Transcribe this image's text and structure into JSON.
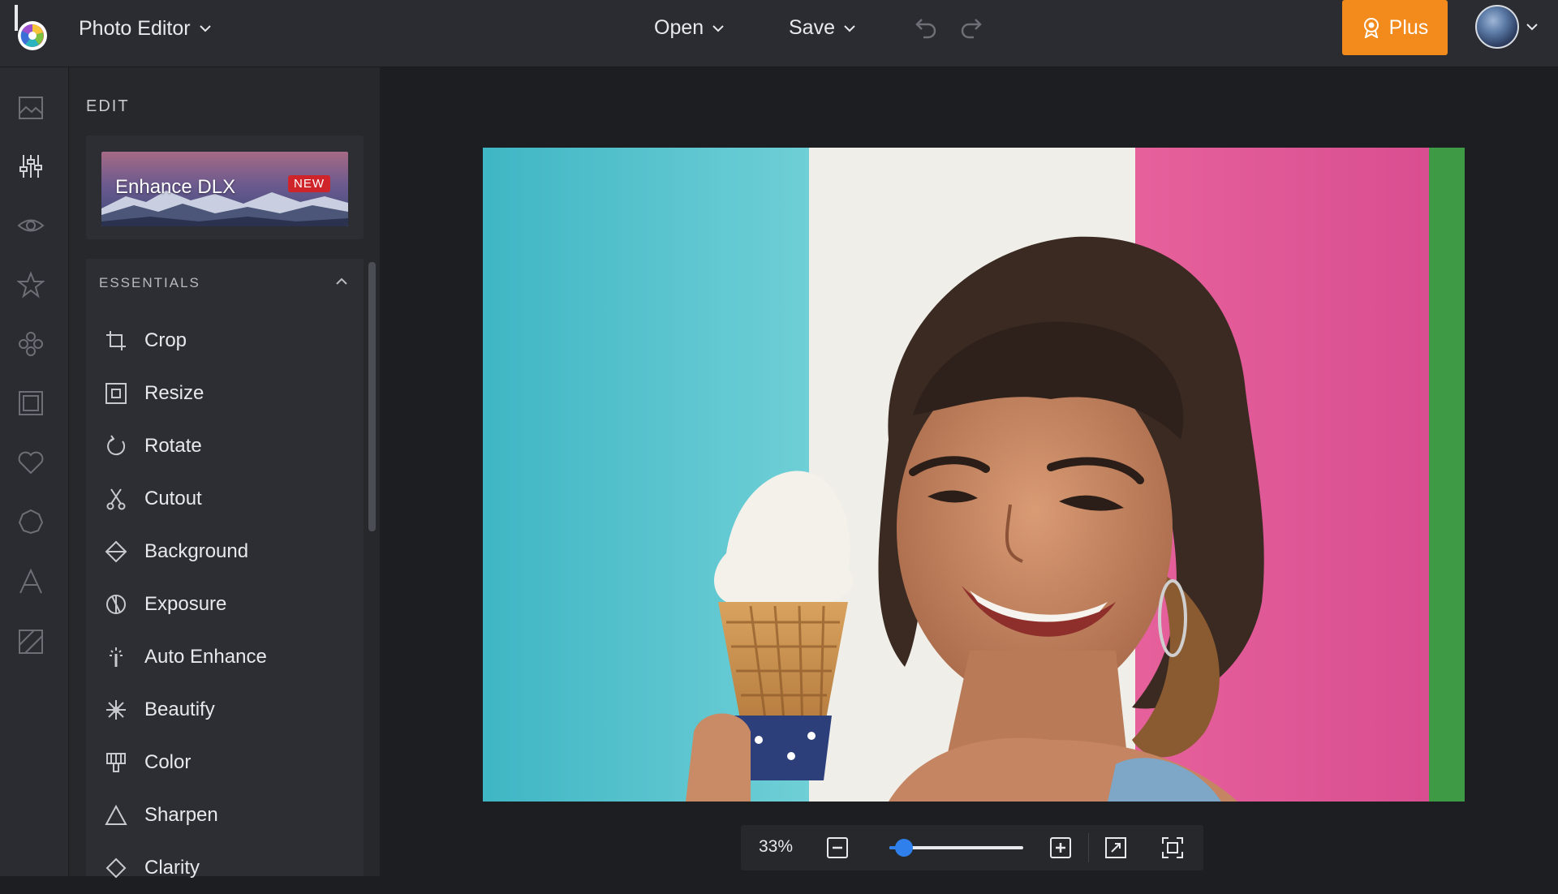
{
  "header": {
    "app_switcher_label": "Photo Editor",
    "menus": [
      {
        "label": "Open"
      },
      {
        "label": "Save"
      }
    ],
    "plus_label": "Plus"
  },
  "rail": {
    "items": [
      {
        "icon": "image-icon"
      },
      {
        "icon": "sliders-icon",
        "active": true
      },
      {
        "icon": "eye-icon"
      },
      {
        "icon": "star-icon"
      },
      {
        "icon": "flower-icon"
      },
      {
        "icon": "frame-icon"
      },
      {
        "icon": "heart-icon"
      },
      {
        "icon": "badge-icon"
      },
      {
        "icon": "text-icon"
      },
      {
        "icon": "texture-icon"
      }
    ]
  },
  "panel": {
    "title": "EDIT",
    "promo": {
      "label": "Enhance DLX",
      "badge": "NEW"
    },
    "section_title": "ESSENTIALS",
    "tools": [
      {
        "label": "Crop",
        "icon": "crop-icon"
      },
      {
        "label": "Resize",
        "icon": "resize-icon"
      },
      {
        "label": "Rotate",
        "icon": "rotate-icon"
      },
      {
        "label": "Cutout",
        "icon": "scissors-icon"
      },
      {
        "label": "Background",
        "icon": "background-icon"
      },
      {
        "label": "Exposure",
        "icon": "exposure-icon"
      },
      {
        "label": "Auto Enhance",
        "icon": "magic-wand-icon"
      },
      {
        "label": "Beautify",
        "icon": "sparkle-icon"
      },
      {
        "label": "Color",
        "icon": "color-icon"
      },
      {
        "label": "Sharpen",
        "icon": "triangle-icon"
      },
      {
        "label": "Clarity",
        "icon": "diamond-icon"
      }
    ]
  },
  "zoom": {
    "value_label": "33%",
    "level": 0.33
  },
  "colors": {
    "accent_orange": "#f28a1c",
    "slider_blue": "#2f80ed",
    "new_badge": "#d0242b"
  }
}
